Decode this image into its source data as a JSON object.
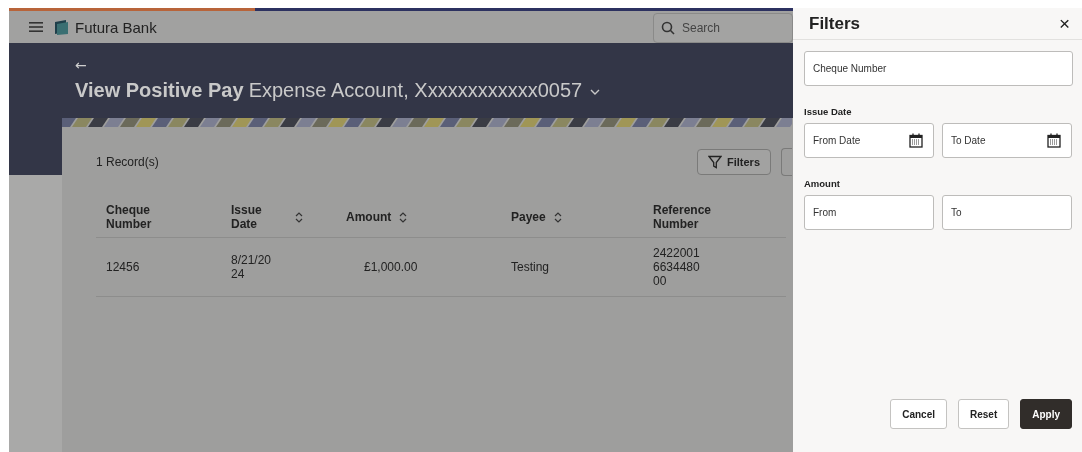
{
  "app_bar": {
    "brand": "Futura Bank",
    "search": {
      "placeholder": "Search"
    }
  },
  "header": {
    "back": "←",
    "title_bold": "View Positive Pay",
    "account": "Expense Account, Xxxxxxxxxxxx0057"
  },
  "records": {
    "count": "1 Record(s)",
    "filter_button": "Filters"
  },
  "table": {
    "columns": [
      {
        "label": "Cheque Number",
        "sortable": false
      },
      {
        "label": "Issue Date",
        "sortable": true
      },
      {
        "label": "Amount",
        "sortable": true
      },
      {
        "label": "Payee",
        "sortable": true
      },
      {
        "label": "Reference Number",
        "sortable": false
      }
    ],
    "rows": [
      {
        "cells": [
          "12456",
          "8/21/20 24",
          "£1,000.00",
          "Testing",
          "2422001 6634480 00"
        ]
      }
    ]
  },
  "filters_panel": {
    "title": "Filters",
    "close": "×",
    "fields": [
      {
        "kind": "text",
        "placeholder": "Cheque Number"
      },
      {
        "kind": "label",
        "text": "Issue Date"
      },
      {
        "kind": "pair",
        "items": [
          {
            "placeholder": "From Date",
            "calendar": true
          },
          {
            "placeholder": "To Date",
            "calendar": true
          }
        ]
      },
      {
        "kind": "label",
        "text": "Amount"
      },
      {
        "kind": "pair",
        "items": [
          {
            "placeholder": "From",
            "calendar": false
          },
          {
            "placeholder": "To",
            "calendar": false
          }
        ]
      }
    ],
    "buttons": [
      {
        "label": "Cancel",
        "primary": false
      },
      {
        "label": "Reset",
        "primary": false
      },
      {
        "label": "Apply",
        "primary": true
      }
    ]
  }
}
